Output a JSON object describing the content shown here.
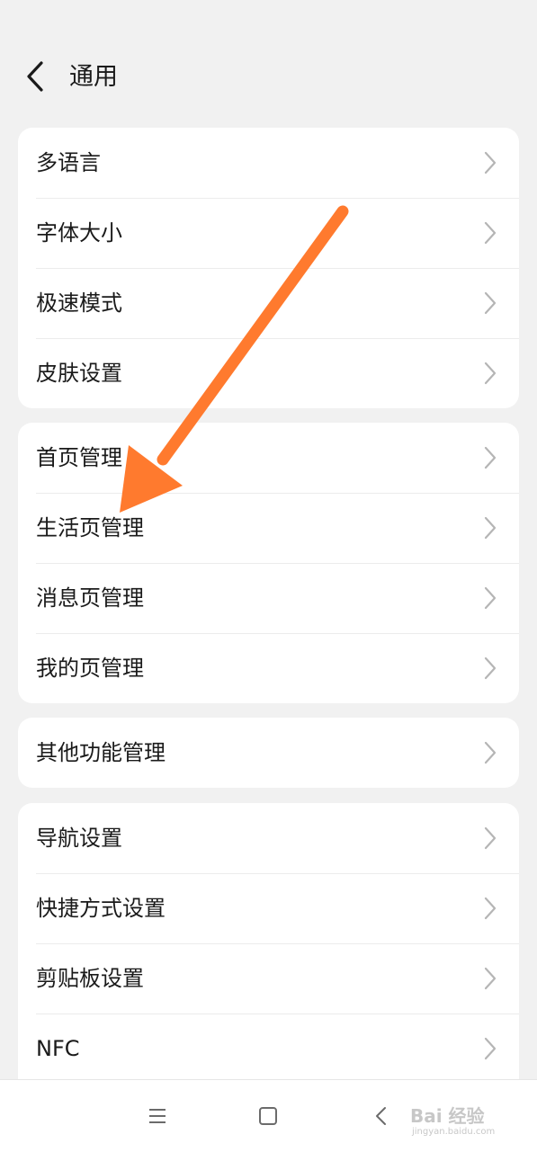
{
  "header": {
    "title": "通用",
    "back_icon": "chevron-left-icon"
  },
  "groups": [
    {
      "items": [
        {
          "label": "多语言"
        },
        {
          "label": "字体大小"
        },
        {
          "label": "极速模式"
        },
        {
          "label": "皮肤设置"
        }
      ]
    },
    {
      "items": [
        {
          "label": "首页管理"
        },
        {
          "label": "生活页管理"
        },
        {
          "label": "消息页管理"
        },
        {
          "label": "我的页管理"
        }
      ]
    },
    {
      "items": [
        {
          "label": "其他功能管理"
        }
      ]
    },
    {
      "items": [
        {
          "label": "导航设置"
        },
        {
          "label": "快捷方式设置"
        },
        {
          "label": "剪贴板设置"
        },
        {
          "label": "NFC"
        }
      ]
    }
  ],
  "navbar": {
    "buttons": [
      "menu-icon",
      "home-icon",
      "back-icon"
    ]
  },
  "watermark": {
    "main": "Bai 经验",
    "sub": "jingyan.baidu.com"
  },
  "annotation": {
    "type": "arrow",
    "color": "#ff7a2e"
  },
  "colors": {
    "background": "#f1f1f1",
    "card": "#ffffff",
    "chevron": "#b5b5b5"
  }
}
